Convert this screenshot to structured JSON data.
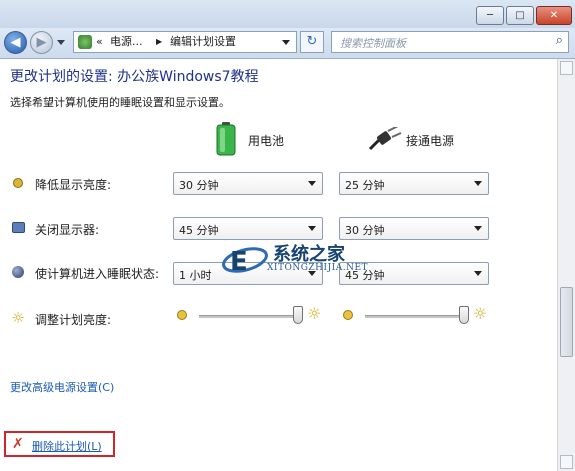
{
  "window": {
    "minimize_glyph": "─",
    "maximize_glyph": "□",
    "close_glyph": "✕"
  },
  "nav": {
    "back_glyph": "◀",
    "forward_glyph": "▶",
    "breadcrumb": [
      "«",
      "电源...",
      "▶",
      "编辑计划设置"
    ],
    "search_placeholder": "搜索控制面板"
  },
  "page": {
    "title": "更改计划的设置: 办公族Windows7教程",
    "subtitle": "选择希望计算机使用的睡眠设置和显示设置。",
    "col_battery": "用电池",
    "col_ac": "接通电源"
  },
  "rows": [
    {
      "label": "降低显示亮度:",
      "battery": "30 分钟",
      "ac": "25 分钟",
      "icon": "dim-display-icon"
    },
    {
      "label": "关闭显示器:",
      "battery": "45 分钟",
      "ac": "30 分钟",
      "icon": "display-off-icon"
    },
    {
      "label": "使计算机进入睡眠状态:",
      "battery": "1 小时",
      "ac": "45 分钟",
      "icon": "sleep-icon"
    }
  ],
  "brightness": {
    "label": "调整计划亮度:",
    "battery_level": 0.95,
    "ac_level": 0.95
  },
  "links": {
    "advanced": "更改高级电源设置(C)",
    "delete": "删除此计划(L)"
  },
  "watermark": {
    "name": "系统之家",
    "url": "XITONGZHIJIA.NET"
  },
  "colors": {
    "title": "#1e3287",
    "link": "#1a5bb5",
    "highlight_box": "#d2242a"
  }
}
